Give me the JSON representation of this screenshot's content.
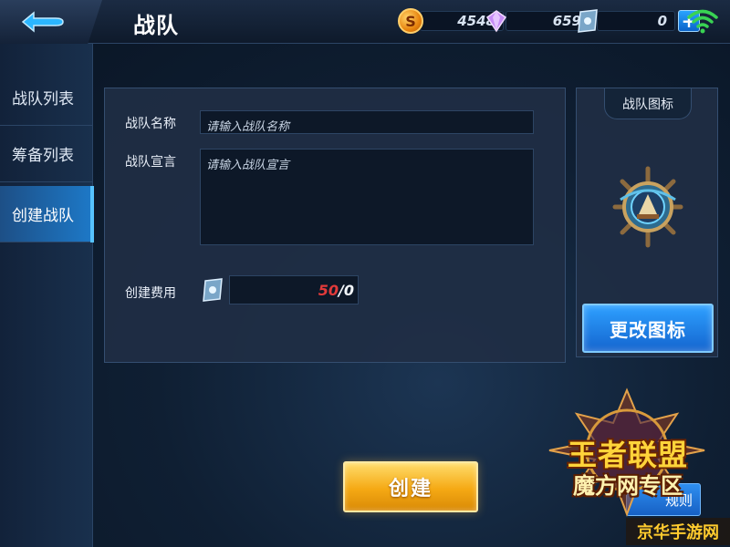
{
  "header": {
    "title": "战队",
    "currencies": {
      "gold": {
        "icon": "gold-coin-icon",
        "symbol": "S",
        "value": "4548"
      },
      "diamond": {
        "icon": "diamond-icon",
        "value": "659"
      },
      "ticket": {
        "icon": "ticket-icon",
        "value": "0"
      }
    },
    "plus_label": "+"
  },
  "sidebar": {
    "items": [
      {
        "label": "战队列表",
        "active": false
      },
      {
        "label": "筹备列表",
        "active": false
      },
      {
        "label": "创建战队",
        "active": true
      }
    ]
  },
  "form": {
    "name_label": "战队名称",
    "name_placeholder": "请输入战队名称",
    "declaration_label": "战队宣言",
    "declaration_placeholder": "请输入战队宣言",
    "cost_label": "创建费用",
    "cost_required": "50",
    "cost_owned": "/0"
  },
  "icon_panel": {
    "title": "战队图标",
    "change_button": "更改图标"
  },
  "actions": {
    "create_button": "创建",
    "partial_button": "规则"
  },
  "watermark": {
    "line1": "王者联盟",
    "line2": "魔方网专区",
    "site": "京华手游网"
  },
  "colors": {
    "accent_blue": "#1d79c8",
    "create_gold": "#f5a914",
    "cost_red": "#e23a3a",
    "wifi_green": "#39d353"
  }
}
